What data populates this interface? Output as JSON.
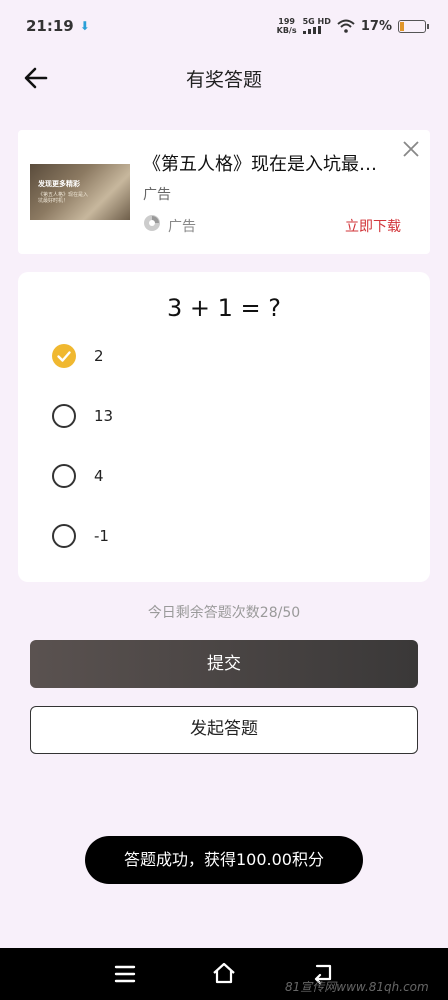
{
  "status_bar": {
    "time": "21:19",
    "speed_value": "199",
    "speed_unit": "KB/s",
    "network": "5G HD",
    "battery_text": "17%",
    "battery_level": 0.17
  },
  "header": {
    "title": "有奖答题"
  },
  "ad": {
    "title": "《第五人格》现在是入坑最…",
    "subtitle": "广告",
    "tag": "广告",
    "download_label": "立即下载",
    "thumb_text_1": "发现更多精彩",
    "thumb_text_2": "《第五人格》现在是入坑最好时机！",
    "accent_color": "#d2353a"
  },
  "quiz": {
    "question": "3 + 1 = ?",
    "options": [
      {
        "label": "2",
        "selected": true
      },
      {
        "label": "13",
        "selected": false
      },
      {
        "label": "4",
        "selected": false
      },
      {
        "label": "-1",
        "selected": false
      }
    ],
    "selected_color": "#f0b830"
  },
  "remaining_text": "今日剩余答题次数28/50",
  "buttons": {
    "submit_label": "提交",
    "start_label": "发起答题"
  },
  "toast": {
    "text": "答题成功，获得100.00积分"
  },
  "watermark": "81宣传网www.81qh.com"
}
